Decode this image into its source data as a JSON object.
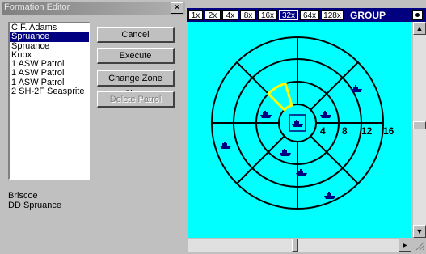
{
  "dialog": {
    "title": "Formation Editor",
    "close_glyph": "×",
    "list_items": [
      {
        "label": "C.F. Adams",
        "selected": false
      },
      {
        "label": "Spruance",
        "selected": true
      },
      {
        "label": "Spruance",
        "selected": false
      },
      {
        "label": "Knox",
        "selected": false
      },
      {
        "label": "1 ASW Patrol",
        "selected": false
      },
      {
        "label": "1 ASW Patrol",
        "selected": false
      },
      {
        "label": "1 ASW Patrol",
        "selected": false
      },
      {
        "label": "2 SH-2F Seasprite",
        "selected": false
      }
    ],
    "buttons": {
      "cancel": "Cancel",
      "execute": "Execute",
      "change_zone_sizes": "Change Zone Sizes",
      "delete_patrol": "Delete Patrol"
    },
    "info_line1": "Briscoe",
    "info_line2": "DD Spruance"
  },
  "viewer": {
    "zoom_levels": [
      "1x",
      "2x",
      "4x",
      "8x",
      "16x",
      "32x",
      "64x",
      "128x"
    ],
    "active_zoom": "32x",
    "group_label": "GROUP",
    "ring_labels": [
      "4",
      "8",
      "12",
      "16"
    ],
    "colors": {
      "water": "#00ffff",
      "ship": "#000080",
      "highlight": "#ffff00",
      "bar": "#000080"
    },
    "ship_icon": "ship-icon",
    "scroll_arrows": {
      "up": "▲",
      "down": "▼",
      "right": "►"
    }
  }
}
